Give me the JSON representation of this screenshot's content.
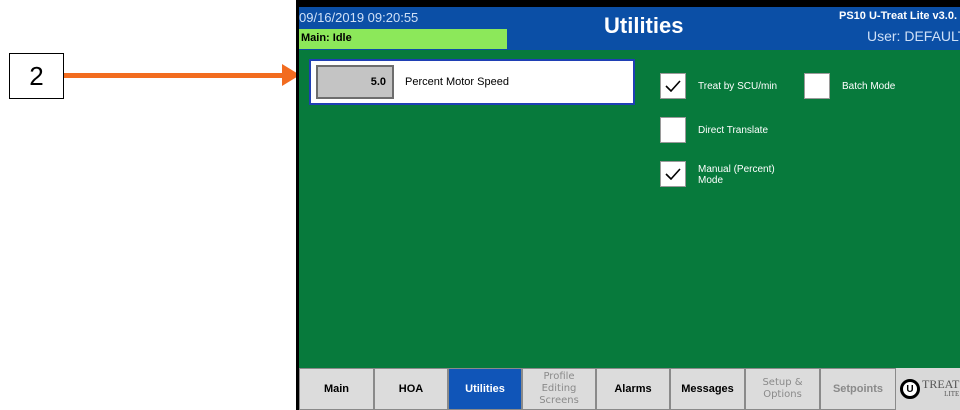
{
  "callout": {
    "number": "2"
  },
  "header": {
    "datetime": "09/16/2019 09:20:55",
    "status": "Main: Idle",
    "title": "Utilities",
    "version": "PS10 U-Treat Lite v3.0.",
    "user": "User: DEFAULT"
  },
  "parameter": {
    "value": "5.0",
    "label": "Percent Motor Speed"
  },
  "options": [
    {
      "label": "Treat by SCU/min",
      "checked": true
    },
    {
      "label": "Batch Mode",
      "checked": false
    },
    {
      "label": "Direct Translate",
      "checked": false
    },
    {
      "label_line1": "Manual (Percent)",
      "label_line2": "Mode",
      "checked": true
    }
  ],
  "tabs": {
    "main": "Main",
    "hoa": "HOA",
    "utilities": "Utilities",
    "profile_line1": "Profile",
    "profile_line2": "Editing",
    "profile_line3": "Screens",
    "alarms": "Alarms",
    "messages": "Messages",
    "setup_line1": "Setup &",
    "setup_line2": "Options",
    "setpoints": "Setpoints"
  },
  "logo": {
    "text": "TREAT",
    "sub": "LITE",
    "mark": "U"
  },
  "colors": {
    "header_blue": "#0b4fa6",
    "status_green": "#8ce85a",
    "background_green": "#077a3c",
    "active_tab": "#1055b8",
    "arrow_orange": "#f26c1f"
  }
}
